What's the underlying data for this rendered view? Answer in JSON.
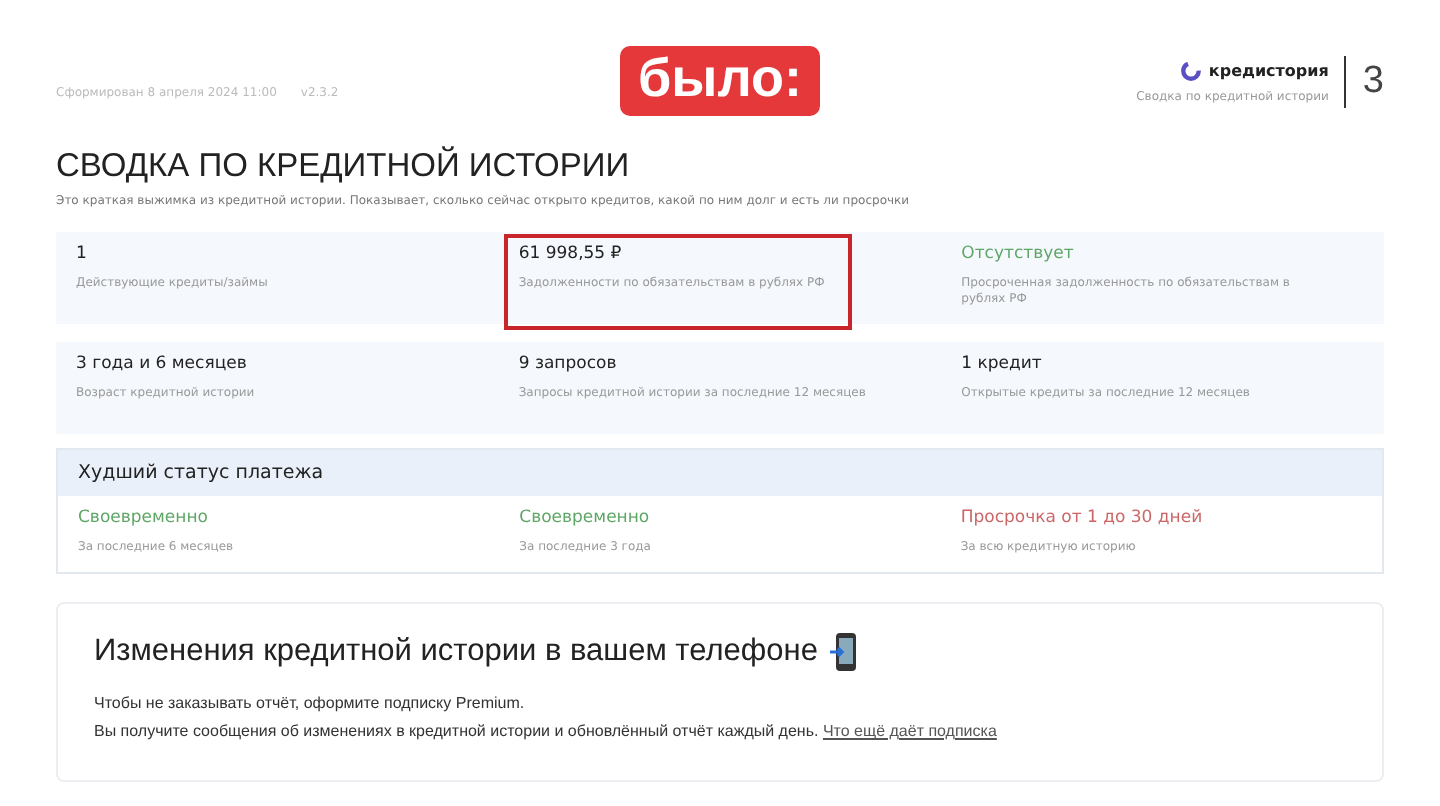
{
  "header": {
    "generated": "Сформирован 8 апреля 2024 11:00",
    "version": "v2.3.2",
    "sticker": "было:",
    "brand": "кредистория",
    "brand_subtitle": "Сводка по кредитной истории",
    "page_number": "3"
  },
  "title": "СВОДКА ПО КРЕДИТНОЙ ИСТОРИИ",
  "subtitle": "Это краткая выжимка из кредитной истории. Показывает, сколько сейчас открыто кредитов, какой по ним долг и есть ли просрочки",
  "summary_rows": [
    [
      {
        "value": "1",
        "label": "Действующие кредиты/займы",
        "kind": "plain",
        "highlighted": false
      },
      {
        "value": "61 998,55 ₽",
        "label": "Задолженности по обязательствам в рублях РФ",
        "kind": "plain",
        "highlighted": true
      },
      {
        "value": "Отсутствует",
        "label": "Просроченная задолженность по обязательствам в рублях РФ",
        "kind": "good",
        "highlighted": false
      }
    ],
    [
      {
        "value": "3 года и 6 месяцев",
        "label": "Возраст кредитной истории",
        "kind": "plain",
        "highlighted": false
      },
      {
        "value": "9 запросов",
        "label": "Запросы кредитной истории за последние 12 месяцев",
        "kind": "plain",
        "highlighted": false
      },
      {
        "value": "1 кредит",
        "label": "Открытые кредиты за последние 12 месяцев",
        "kind": "plain",
        "highlighted": false
      }
    ]
  ],
  "worst_status": {
    "title": "Худший статус платежа",
    "items": [
      {
        "value": "Своевременно",
        "label": "За последние 6 месяцев",
        "kind": "good"
      },
      {
        "value": "Своевременно",
        "label": "За последние 3 года",
        "kind": "good"
      },
      {
        "value": "Просрочка от 1 до 30 дней",
        "label": "За всю кредитную историю",
        "kind": "bad"
      }
    ]
  },
  "promo": {
    "title": "Изменения кредитной истории в вашем телефоне",
    "line_1": "Чтобы не заказывать отчёт, оформите подписку Premium.",
    "line_2": "Вы получите сообщения об изменениях в кредитной истории и обновлённый отчёт каждый день.",
    "link": "Что ещё даёт подписка"
  }
}
